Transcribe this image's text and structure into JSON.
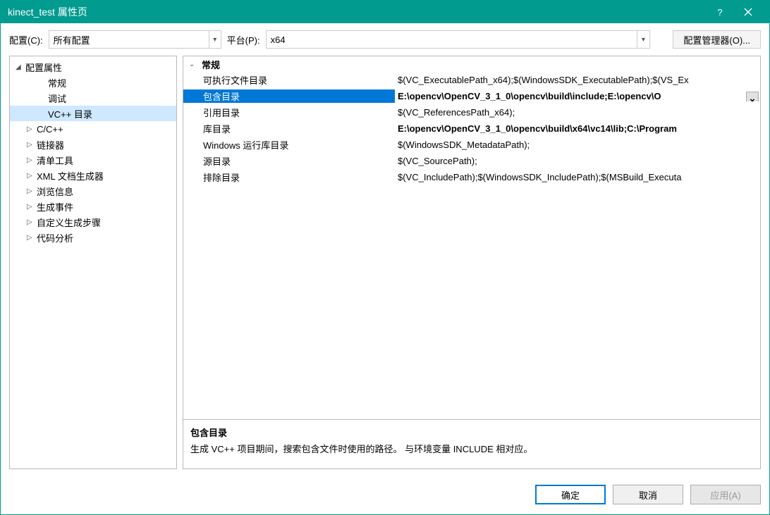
{
  "title": "kinect_test 属性页",
  "topbar": {
    "config_label": "配置(C):",
    "config_value": "所有配置",
    "platform_label": "平台(P):",
    "platform_value": "x64",
    "manager_label": "配置管理器(O)..."
  },
  "tree": {
    "root": "配置属性",
    "items": [
      {
        "label": "常规",
        "indent": 2,
        "exp": ""
      },
      {
        "label": "调试",
        "indent": 2,
        "exp": ""
      },
      {
        "label": "VC++ 目录",
        "indent": 2,
        "exp": "",
        "selected": true
      },
      {
        "label": "C/C++",
        "indent": 1,
        "exp": "▷"
      },
      {
        "label": "链接器",
        "indent": 1,
        "exp": "▷"
      },
      {
        "label": "清单工具",
        "indent": 1,
        "exp": "▷"
      },
      {
        "label": "XML 文档生成器",
        "indent": 1,
        "exp": "▷"
      },
      {
        "label": "浏览信息",
        "indent": 1,
        "exp": "▷"
      },
      {
        "label": "生成事件",
        "indent": 1,
        "exp": "▷"
      },
      {
        "label": "自定义生成步骤",
        "indent": 1,
        "exp": "▷"
      },
      {
        "label": "代码分析",
        "indent": 1,
        "exp": "▷"
      }
    ]
  },
  "grid": {
    "group": "常规",
    "rows": [
      {
        "name": "可执行文件目录",
        "value": "$(VC_ExecutablePath_x64);$(WindowsSDK_ExecutablePath);$(VS_Ex",
        "bold": false
      },
      {
        "name": "包含目录",
        "value": "E:\\opencv\\OpenCV_3_1_0\\opencv\\build\\include;E:\\opencv\\O",
        "bold": true,
        "selected": true,
        "dd": true
      },
      {
        "name": "引用目录",
        "value": "$(VC_ReferencesPath_x64);",
        "bold": false
      },
      {
        "name": "库目录",
        "value": "E:\\opencv\\OpenCV_3_1_0\\opencv\\build\\x64\\vc14\\lib;C:\\Program",
        "bold": true
      },
      {
        "name": "Windows 运行库目录",
        "value": "$(WindowsSDK_MetadataPath);",
        "bold": false
      },
      {
        "name": "源目录",
        "value": "$(VC_SourcePath);",
        "bold": false
      },
      {
        "name": "排除目录",
        "value": "$(VC_IncludePath);$(WindowsSDK_IncludePath);$(MSBuild_Executa",
        "bold": false
      }
    ]
  },
  "desc": {
    "title": "包含目录",
    "text": "生成 VC++ 项目期间，搜索包含文件时使用的路径。 与环境变量 INCLUDE 相对应。"
  },
  "footer": {
    "ok": "确定",
    "cancel": "取消",
    "apply": "应用(A)"
  }
}
